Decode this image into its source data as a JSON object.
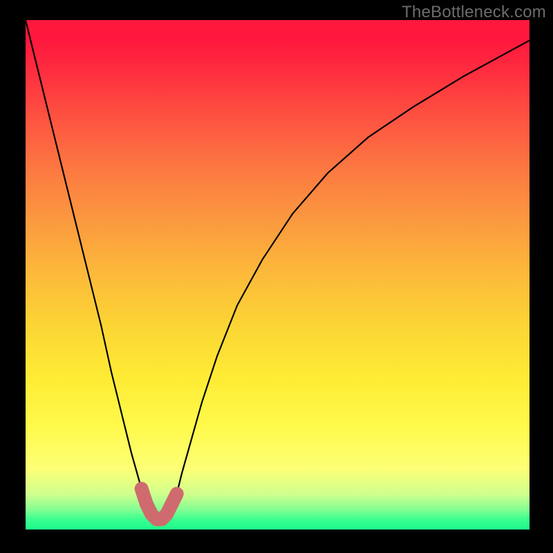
{
  "watermark": "TheBottleneck.com",
  "chart_data": {
    "type": "line",
    "title": "",
    "xlabel": "",
    "ylabel": "",
    "xlim": [
      0,
      100
    ],
    "ylim": [
      0,
      100
    ],
    "series": [
      {
        "name": "curve",
        "x": [
          0,
          3,
          6,
          9,
          12,
          15,
          17,
          19,
          21,
          23,
          24.5,
          26,
          27.5,
          29,
          30,
          31,
          33,
          35,
          38,
          42,
          47,
          53,
          60,
          68,
          77,
          87,
          100
        ],
        "values": [
          100,
          88,
          76,
          64,
          52,
          40,
          31,
          23,
          15,
          8,
          4,
          2,
          2,
          4,
          7,
          11,
          18,
          25,
          34,
          44,
          53,
          62,
          70,
          77,
          83,
          89,
          96
        ]
      },
      {
        "name": "valley-highlight",
        "x": [
          23,
          24,
          25,
          26,
          27,
          28,
          29,
          30
        ],
        "values": [
          8,
          5,
          3,
          2,
          2,
          3,
          5,
          7
        ]
      }
    ],
    "gradient_stops": [
      {
        "pos": 0,
        "color": "#fe183c"
      },
      {
        "pos": 10,
        "color": "#fe2d3e"
      },
      {
        "pos": 20,
        "color": "#fd5641"
      },
      {
        "pos": 30,
        "color": "#fc7b41"
      },
      {
        "pos": 40,
        "color": "#fb9b3f"
      },
      {
        "pos": 50,
        "color": "#fcba3a"
      },
      {
        "pos": 60,
        "color": "#fcd534"
      },
      {
        "pos": 70,
        "color": "#feeb34"
      },
      {
        "pos": 80,
        "color": "#fffa4c"
      },
      {
        "pos": 90,
        "color": "#d1ff8d"
      },
      {
        "pos": 100,
        "color": "#1bfc8c"
      }
    ]
  }
}
